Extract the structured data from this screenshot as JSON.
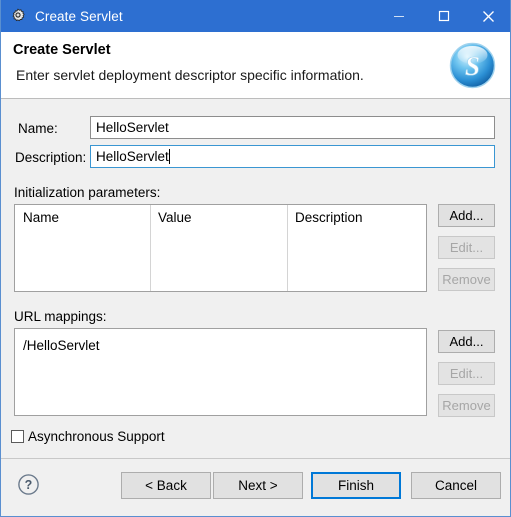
{
  "window": {
    "title": "Create Servlet",
    "icon": "servlet-gear-icon",
    "titlebar_color": "#2d6fd1",
    "controls": {
      "minimize": "—",
      "maximize": "□",
      "close": "✕"
    }
  },
  "header": {
    "title": "Create Servlet",
    "description": "Enter servlet deployment descriptor specific information.",
    "logo": "spring-s-sphere-logo",
    "logo_letter": "S"
  },
  "form": {
    "name_label": "Name:",
    "name_value": "HelloServlet",
    "name_placeholder": "",
    "description_label": "Description:",
    "description_value": "HelloServlet",
    "description_placeholder": "",
    "description_focused": true
  },
  "init_params": {
    "section_label": "Initialization parameters:",
    "columns": [
      "Name",
      "Value",
      "Description"
    ],
    "rows": [],
    "buttons": [
      {
        "label": "Add...",
        "enabled": true
      },
      {
        "label": "Edit...",
        "enabled": false
      },
      {
        "label": "Remove",
        "enabled": false
      }
    ]
  },
  "url_mappings": {
    "section_label": "URL mappings:",
    "items": [
      "/HelloServlet"
    ],
    "buttons": [
      {
        "label": "Add...",
        "enabled": true
      },
      {
        "label": "Edit...",
        "enabled": false
      },
      {
        "label": "Remove",
        "enabled": false
      }
    ]
  },
  "async": {
    "label": "Asynchronous Support",
    "checked": false
  },
  "footer": {
    "help": "?",
    "back": "< Back",
    "next": "Next >",
    "finish": "Finish",
    "cancel": "Cancel",
    "focus_color": "#0078d7"
  }
}
